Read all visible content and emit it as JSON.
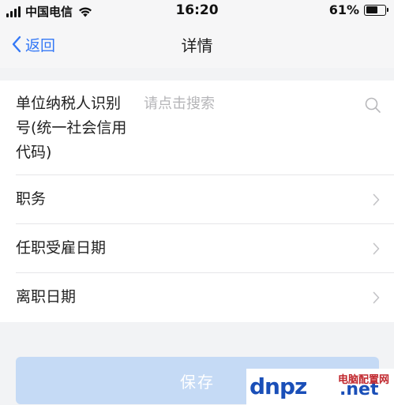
{
  "status_bar": {
    "carrier": "中国电信",
    "time": "16:20",
    "battery_percent": "61%",
    "battery_level": 0.61,
    "signal_icon": "cellular-signal-icon",
    "wifi_icon": "wifi-icon"
  },
  "nav": {
    "back_label": "返回",
    "title": "详情"
  },
  "form": {
    "taxid": {
      "label": "单位纳税人识别号(统一社会信用代码)",
      "value": "",
      "placeholder": "请点击搜索"
    },
    "position": {
      "label": "职务"
    },
    "hire_date": {
      "label": "任职受雇日期"
    },
    "leave_date": {
      "label": "离职日期"
    }
  },
  "save_label": "保存",
  "watermark": {
    "logo": "dnpz",
    "suffix": ".net",
    "site_name": "电脑配置网"
  },
  "colors": {
    "accent": "#3478f6",
    "button_disabled": "#c5daf5",
    "page_bg": "#f2f3f5",
    "placeholder": "#b5b5b8"
  }
}
